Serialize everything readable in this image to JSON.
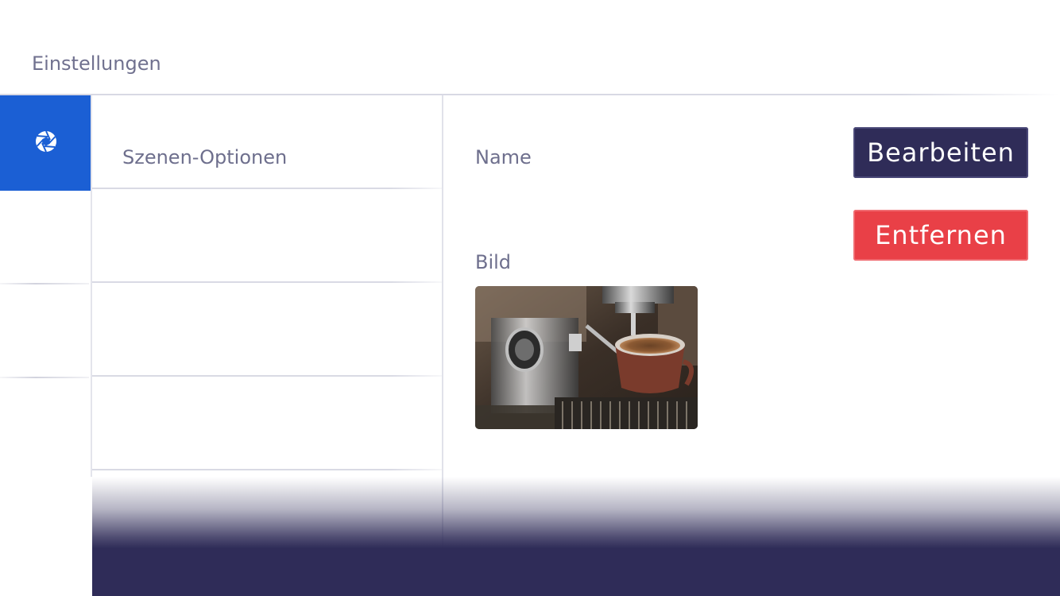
{
  "header": {
    "title": "Einstellungen"
  },
  "sidebar": {
    "items": [
      {
        "icon": "aperture-icon",
        "active": true
      }
    ],
    "active_color": "#1b5fd4"
  },
  "list": {
    "header": "Szenen-Optionen"
  },
  "detail": {
    "name_label": "Name",
    "image_label": "Bild",
    "image_subject": "espresso-machine-coffee-cup",
    "edit_button": "Bearbeiten",
    "remove_button": "Entfernen"
  },
  "colors": {
    "primary_dark": "#2f2c58",
    "danger": "#e94047",
    "accent_blue": "#1b5fd4",
    "text_muted": "#6e6f8d"
  }
}
